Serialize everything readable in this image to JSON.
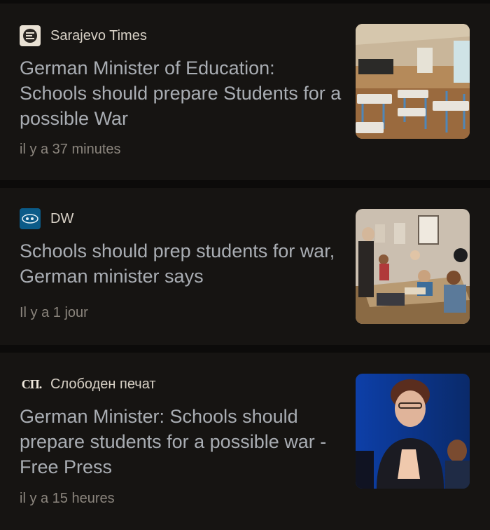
{
  "articles": [
    {
      "source": "Sarajevo Times",
      "title": "German Minister of Education: Schools should prepare Students for a possible War",
      "time": "il y a 37 minutes"
    },
    {
      "source": "DW",
      "title": "Schools should prep students for war, German minister says",
      "time": "Il y a 1 jour"
    },
    {
      "source": "Слободен печат",
      "source_logo_text": "СП.",
      "title": "German Minister: Schools should prepare students for a possible war - Free Press",
      "time": "il y a 15 heures"
    }
  ],
  "colors": {
    "background": "#0c0b0a",
    "card": "#161412",
    "headline": "#a9adb3",
    "source": "#d8d1c6",
    "time": "#8b857d"
  }
}
